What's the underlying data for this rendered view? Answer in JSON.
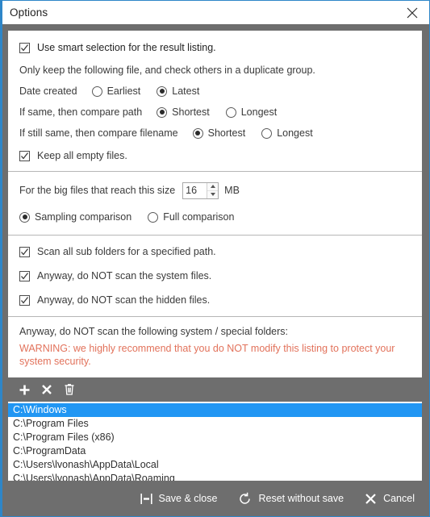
{
  "window": {
    "title": "Options",
    "close_label": "×",
    "accent_color": "#2e86c8",
    "chrome_color": "#6e6e6e"
  },
  "sections": {
    "smart_selection": {
      "checkbox_label": "Use smart selection for the result listing.",
      "checked": true,
      "description": "Only keep the following file, and check others in a duplicate group.",
      "rows": [
        {
          "label": "Date created",
          "options": [
            "Earliest",
            "Latest"
          ],
          "selected": "Latest"
        },
        {
          "label": "If same, then compare path",
          "options": [
            "Shortest",
            "Longest"
          ],
          "selected": "Shortest"
        },
        {
          "label": "If still same, then compare filename",
          "options": [
            "Shortest",
            "Longest"
          ],
          "selected": "Shortest"
        }
      ],
      "keep_empty_label": "Keep all empty files.",
      "keep_empty_checked": true
    },
    "big_files": {
      "label": "For the big files that reach this size",
      "size_value": "16",
      "unit": "MB",
      "options": [
        "Sampling comparison",
        "Full comparison"
      ],
      "selected": "Sampling comparison"
    },
    "scan_options": [
      {
        "label": "Scan all sub folders for a specified path.",
        "checked": true
      },
      {
        "label": "Anyway, do NOT scan the system files.",
        "checked": true
      },
      {
        "label": "Anyway, do NOT scan the hidden files.",
        "checked": true
      }
    ],
    "excluded": {
      "note": "Anyway, do NOT scan the following system / special folders:",
      "warning": "WARNING: we highly recommend that you do NOT modify this listing to protect your system security.",
      "warning_color": "#e2725b",
      "toolbar": [
        {
          "name": "add-icon",
          "tooltip": "Add"
        },
        {
          "name": "remove-icon",
          "tooltip": "Remove"
        },
        {
          "name": "trash-icon",
          "tooltip": "Delete all"
        }
      ],
      "paths": [
        "C:\\Windows",
        "C:\\Program Files",
        "C:\\Program Files (x86)",
        "C:\\ProgramData",
        "C:\\Users\\lvonash\\AppData\\Local",
        "C:\\Users\\lvonash\\AppData\\Roaming"
      ],
      "selected_index": 0,
      "selection_color": "#2196f3"
    }
  },
  "footer": {
    "save": "Save & close",
    "reset": "Reset without save",
    "cancel": "Cancel"
  }
}
